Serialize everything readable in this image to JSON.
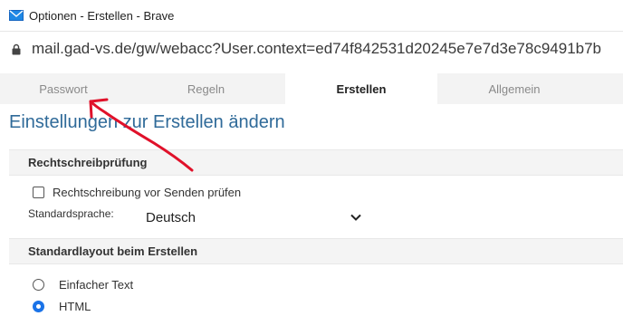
{
  "browser": {
    "title": "Optionen - Erstellen - Brave",
    "url": "mail.gad-vs.de/gw/webacc?User.context=ed74f842531d20245e7e7d3e78c9491b7b"
  },
  "tabs": [
    {
      "label": "Passwort",
      "active": false
    },
    {
      "label": "Regeln",
      "active": false
    },
    {
      "label": "Erstellen",
      "active": true
    },
    {
      "label": "Allgemein",
      "active": false
    }
  ],
  "page": {
    "title": "Einstellungen zur Erstellen ändern"
  },
  "spellcheck": {
    "heading": "Rechtschreibprüfung",
    "checkbox_label": "Rechtschreibung vor Senden prüfen",
    "checkbox_checked": false,
    "language_label": "Standardsprache:",
    "language_value": "Deutsch"
  },
  "layout": {
    "heading": "Standardlayout beim Erstellen",
    "options": [
      {
        "label": "Einfacher Text",
        "selected": false
      },
      {
        "label": "HTML",
        "selected": true
      }
    ]
  },
  "colors": {
    "title_blue": "#2f6a99",
    "annotation_red": "#e0112a"
  }
}
